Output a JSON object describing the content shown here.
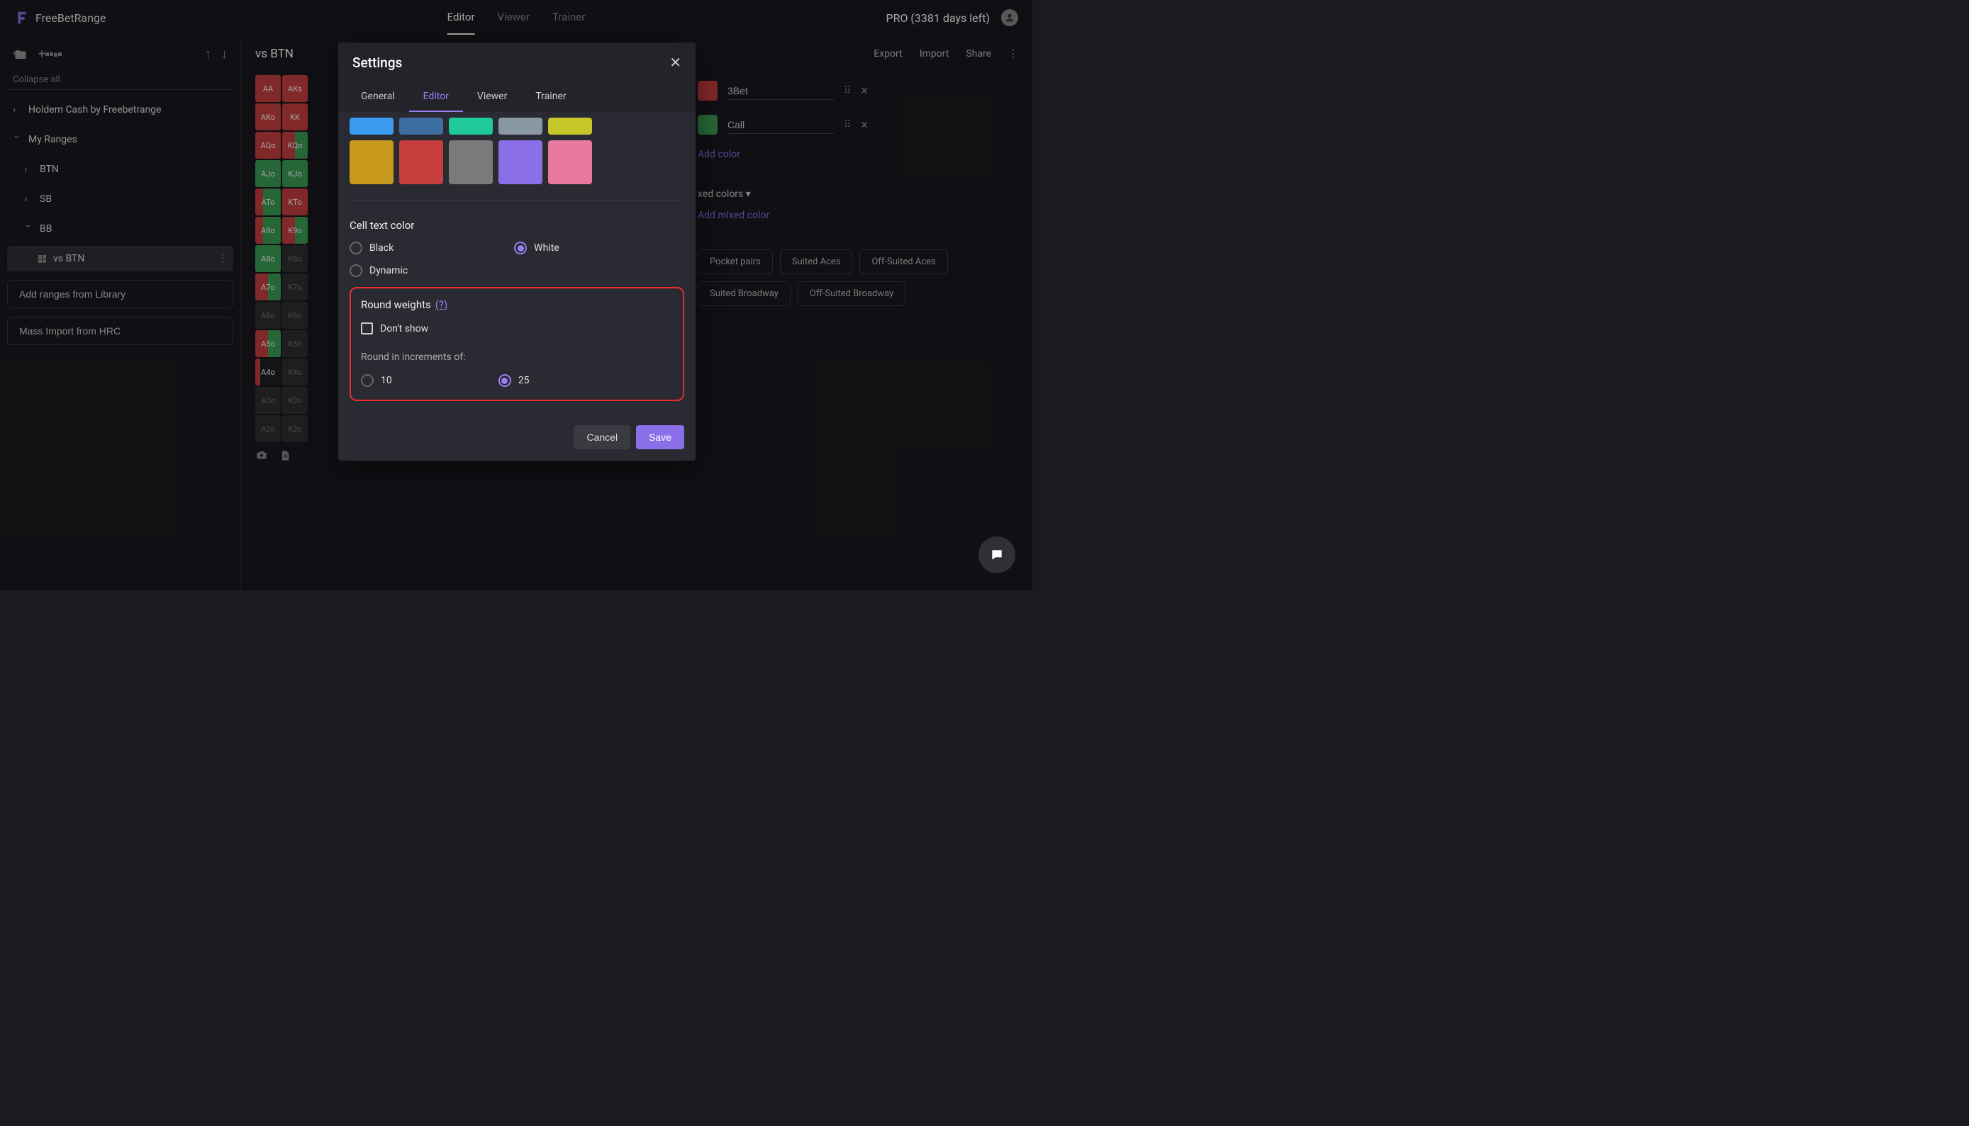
{
  "header": {
    "brand": "FreeBetRange",
    "tabs": {
      "editor": "Editor",
      "viewer": "Viewer",
      "trainer": "Trainer"
    },
    "pro": "PRO (3381 days left)"
  },
  "sidebar": {
    "collapse": "Collapse all",
    "tree": {
      "holdem": "Holdem Cash by Freebetrange",
      "myRanges": "My Ranges",
      "btn": "BTN",
      "sb": "SB",
      "bb": "BB",
      "vsBtn": "vs BTN"
    },
    "addLibrary": "Add ranges from Library",
    "massImport": "Mass Import from HRC"
  },
  "main": {
    "title": "vs BTN",
    "actions": {
      "export": "Export",
      "import": "Import",
      "share": "Share"
    }
  },
  "grid": {
    "r0": [
      "AA",
      "AKs"
    ],
    "r1": [
      "AKo",
      "KK"
    ],
    "r2": [
      "AQo",
      "KQo"
    ],
    "r3": [
      "AJo",
      "KJo"
    ],
    "r4": [
      "ATo",
      "KTo"
    ],
    "r5": [
      "A9o",
      "K9o"
    ],
    "r6": [
      "A8o",
      "K8o"
    ],
    "r7": [
      "A7o",
      "K7o"
    ],
    "r8": [
      "A6o",
      "K6o"
    ],
    "r9": [
      "A5o",
      "K5o"
    ],
    "r10": [
      "A4o",
      "K4o"
    ],
    "r11": [
      "A3o",
      "K3o"
    ],
    "r12": [
      "A2o",
      "K2o"
    ]
  },
  "right": {
    "bet3": "3Bet",
    "call": "Call",
    "addColor": "Add color",
    "mixed": "xed colors ▾",
    "addMixed": "Add mixed color",
    "tags": {
      "pocket": "Pocket pairs",
      "suitedAces": "Suited Aces",
      "offAces": "Off-Suited Aces",
      "suitedBroadway": "Suited Broadway",
      "offBroadway": "Off-Suited Broadway"
    }
  },
  "modal": {
    "title": "Settings",
    "tabs": {
      "general": "General",
      "editor": "Editor",
      "viewer": "Viewer",
      "trainer": "Trainer"
    },
    "colors1": [
      "#3a9bf0",
      "#3c6ea0",
      "#1ec99a",
      "#8a98a4",
      "#c4c727"
    ],
    "colors2": [
      "#c79a1e",
      "#c73e3e",
      "#7a7a7a",
      "#8b6fe8",
      "#e87aa0"
    ],
    "cellTextTitle": "Cell text color",
    "radios": {
      "black": "Black",
      "white": "White",
      "dynamic": "Dynamic"
    },
    "roundTitle": "Round weights",
    "help": "(?)",
    "dontShow": "Don't show",
    "roundIncr": "Round in increments of:",
    "opt10": "10",
    "opt25": "25",
    "cancel": "Cancel",
    "save": "Save"
  }
}
